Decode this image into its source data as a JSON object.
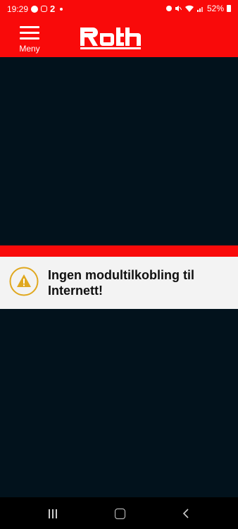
{
  "status_bar": {
    "time": "19:29",
    "battery": "52%",
    "left_icons": [
      "messenger-icon",
      "instagram-icon",
      "app-2-icon",
      "dot"
    ],
    "right_icons": [
      "alarm-icon",
      "mute-icon",
      "wifi-icon",
      "signal-icon",
      "battery-icon"
    ]
  },
  "header": {
    "menu_label": "Meny",
    "logo_text": "Roth",
    "background": "#f90a0a"
  },
  "alert": {
    "icon": "warning-icon",
    "message": "Ingen modultilkobling til Internett!",
    "stripe_color": "#f90a0a",
    "icon_color": "#e0a81f"
  },
  "nav_bar": {
    "buttons": [
      "recent-apps",
      "home",
      "back"
    ]
  },
  "colors": {
    "background": "#02121c",
    "accent": "#f90a0a"
  }
}
